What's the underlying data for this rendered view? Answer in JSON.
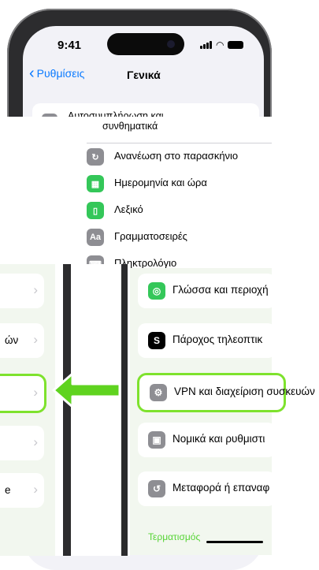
{
  "status_bar": {
    "time": "9:41"
  },
  "nav": {
    "back_label": "Ρυθμίσεις",
    "title": "Γενικά"
  },
  "top_row": {
    "label": "Αυτοσυμπλήρωση και"
  },
  "zoom_menu": {
    "title_part": "συνθηματικά",
    "items": [
      {
        "label": "Ανανέωση στο παρασκήνιο",
        "icon": "refresh-icon",
        "color": "#8e8e93"
      },
      {
        "label": "Ημερομηνία και ώρα",
        "icon": "calendar-clock-icon",
        "color": "#34c759"
      },
      {
        "label": "Λεξικό",
        "icon": "book-icon",
        "color": "#34c759"
      },
      {
        "label": "Γραμματοσειρές",
        "icon": "font-icon",
        "color": "#8e8e93"
      },
      {
        "label": "Πληκτρολόγιο",
        "icon": "keyboard-icon",
        "color": "#8e8e93"
      }
    ]
  },
  "list": [
    {
      "label": "Γλώσσα και περιοχή",
      "icon": "globe-icon",
      "color": "#34c759"
    },
    {
      "label": "Πάροχος τηλεοπτικ",
      "icon": "tv-provider-icon",
      "color": "#000000"
    },
    {
      "label": "VPN και διαχείριση συσκευών",
      "icon": "gear-icon",
      "color": "#8e8e93",
      "highlight": true
    },
    {
      "label": "Νομικά και ρυθμιστι",
      "icon": "legal-icon",
      "color": "#8e8e93"
    },
    {
      "label": "Μεταφορά ή επαναφ",
      "icon": "reset-icon",
      "color": "#8e8e93"
    }
  ],
  "section_footer": "Τερματισμός",
  "left_view": [
    {
      "text": ""
    },
    {
      "text": "ών"
    },
    {
      "text": "",
      "highlight": true
    },
    {
      "text": ""
    },
    {
      "text": "e"
    }
  ],
  "colors": {
    "accent": "#0a7aff",
    "highlight": "#7ee22d",
    "arrow": "#5fd31f"
  }
}
